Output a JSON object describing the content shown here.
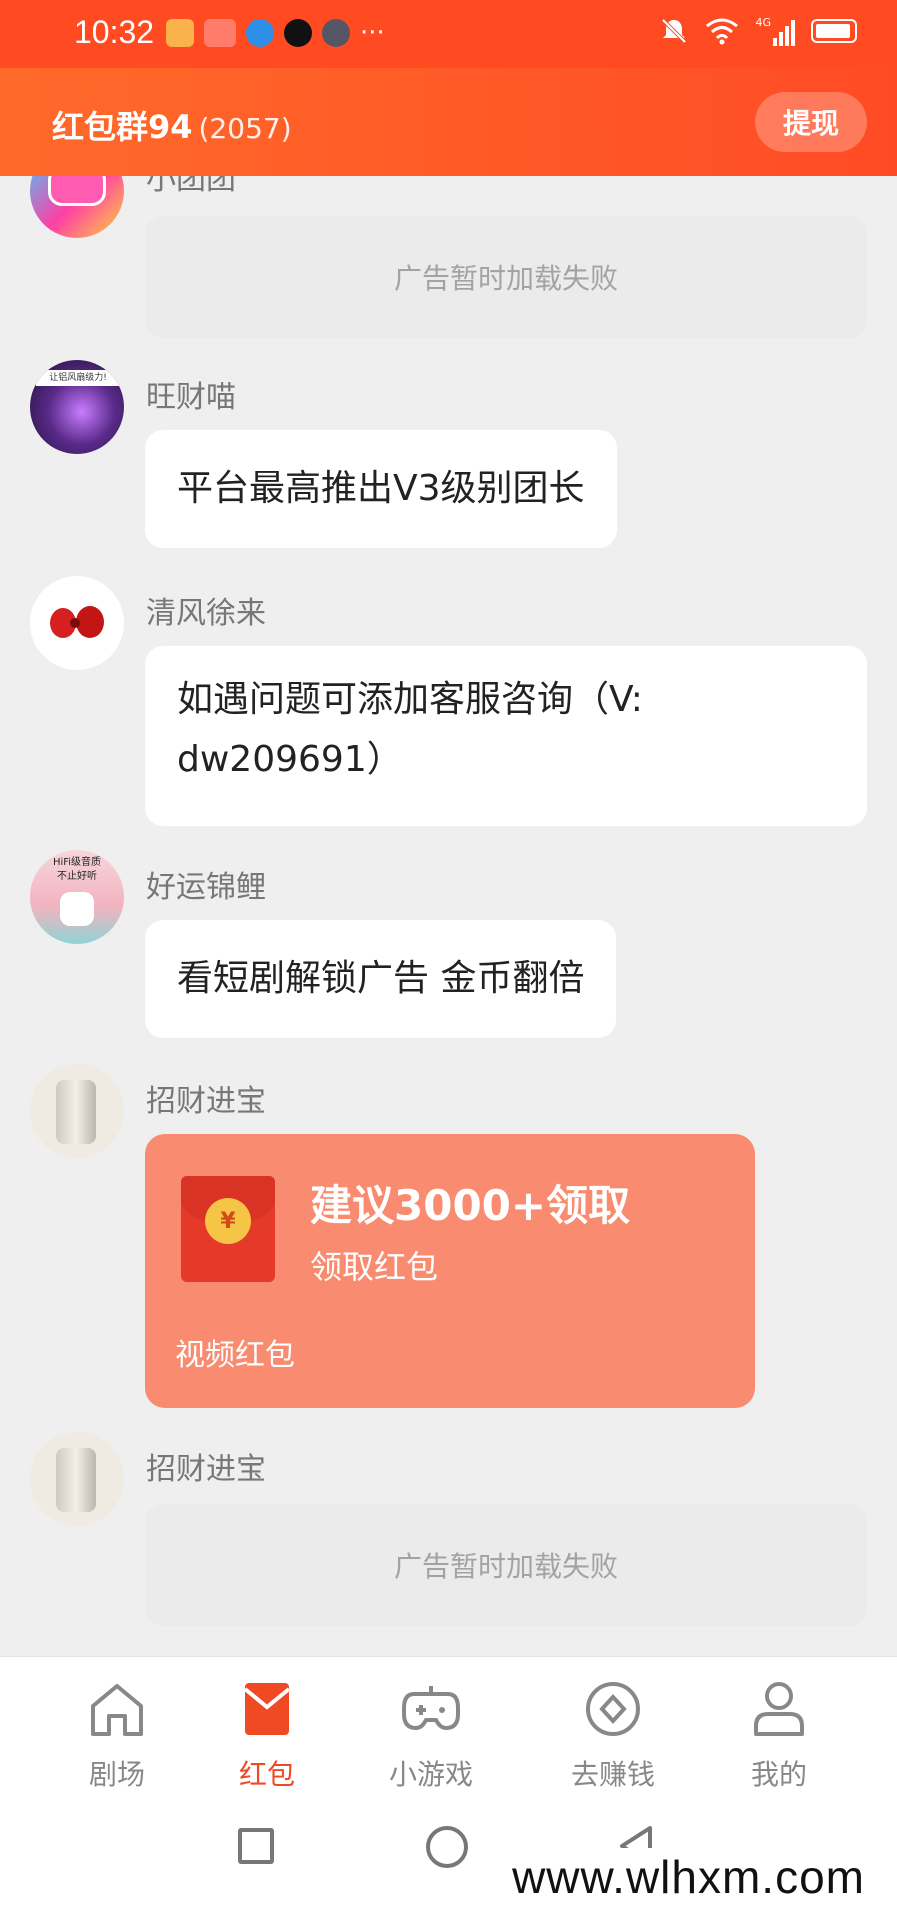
{
  "status_bar": {
    "time": "10:32",
    "left_icons": [
      "notification-app-icon",
      "huawei-app-icon",
      "browser-app-icon",
      "qq-icon",
      "avatar-app-icon"
    ],
    "more_indicator": "···",
    "right_icons": [
      "mute-bell-icon",
      "wifi-icon",
      "signal-4g-icon",
      "battery-icon"
    ],
    "network": "4G"
  },
  "header": {
    "title": "红包群94",
    "member_count": "(2057)",
    "withdraw_label": "提现"
  },
  "messages": [
    {
      "sender": "小团团",
      "type": "ad",
      "text": "广告暂时加载失败"
    },
    {
      "sender": "旺财喵",
      "type": "text",
      "text": "平台最高推出V3级别团长"
    },
    {
      "sender": "清风徐来",
      "type": "text",
      "text": "如遇问题可添加客服咨询（V:",
      "text2": "dw209691）"
    },
    {
      "sender": "好运锦鲤",
      "type": "text",
      "text": "看短剧解锁广告 金币翻倍"
    },
    {
      "sender": "招财进宝",
      "type": "red_packet",
      "title": "建议3000+领取",
      "subtitle": "领取红包",
      "footer": "视频红包",
      "coin_symbol": "¥"
    },
    {
      "sender": "招财进宝",
      "type": "ad",
      "text": "广告暂时加载失败"
    }
  ],
  "avatar_texts": {
    "wangcai": "让铝风扇级力!",
    "haoyun_line1": "HiFi级音质",
    "haoyun_line2": "不止好听"
  },
  "bottom_nav": [
    {
      "label": "剧场",
      "icon": "home-icon",
      "active": false
    },
    {
      "label": "红包",
      "icon": "red-envelope-icon",
      "active": true
    },
    {
      "label": "小游戏",
      "icon": "gamepad-icon",
      "active": false
    },
    {
      "label": "去赚钱",
      "icon": "coin-circle-icon",
      "active": false
    },
    {
      "label": "我的",
      "icon": "person-icon",
      "active": false
    }
  ],
  "watermark": "www.wlhxm.com",
  "colors": {
    "accent": "#ff4a22",
    "red_packet_bg": "#f88b70",
    "active_nav": "#f04a24",
    "inactive_nav": "#888888"
  }
}
